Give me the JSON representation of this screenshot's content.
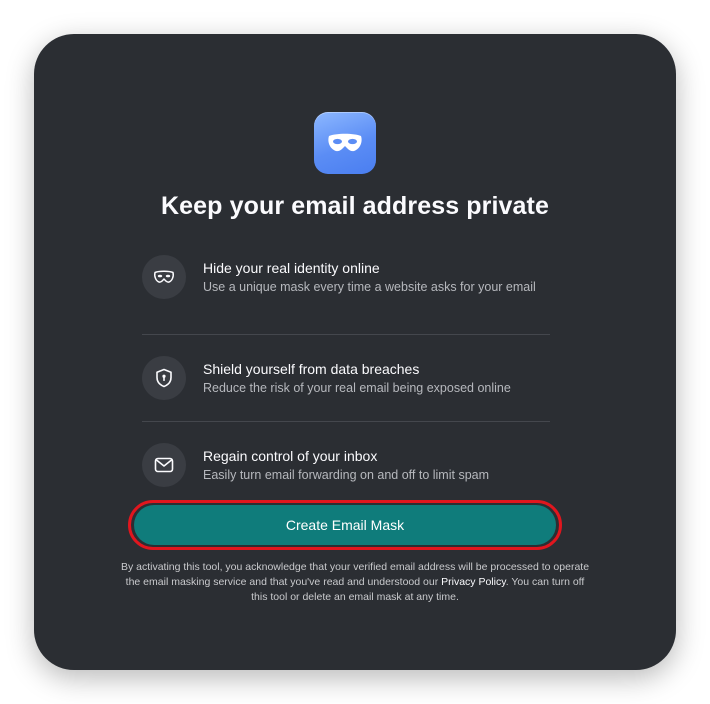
{
  "onboarding": {
    "headline": "Keep your email address private",
    "app_icon": "mask-icon",
    "features": [
      {
        "icon": "mask-icon",
        "title": "Hide your real identity online",
        "description": "Use a unique mask every time a website asks for your email"
      },
      {
        "icon": "shield-lock-icon",
        "title": "Shield yourself from data breaches",
        "description": "Reduce the risk of your real email being exposed online"
      },
      {
        "icon": "envelope-icon",
        "title": "Regain control of your inbox",
        "description": "Easily turn email forwarding on and off to limit spam"
      }
    ],
    "cta_label": "Create Email Mask",
    "disclaimer": {
      "before_link": "By activating this tool, you acknowledge that your verified email address will be processed to operate the email masking service and that you've read and understood our ",
      "link_label": "Privacy Policy",
      "after_link": ". You can turn off this tool or delete an email mask at any time."
    }
  },
  "colors": {
    "card_background": "#2b2e33",
    "cta_background": "#0f7c7b",
    "highlight_outline": "#e0161e",
    "app_icon_blue": "#5b8df5"
  }
}
